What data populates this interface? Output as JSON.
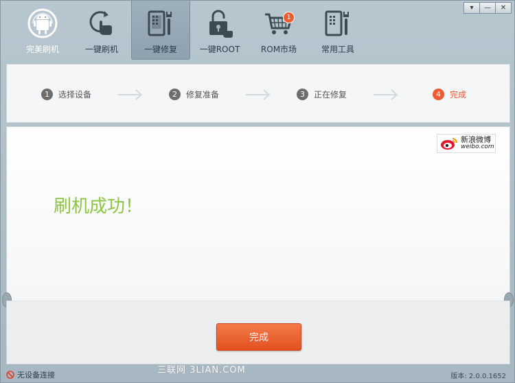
{
  "window": {
    "controls": [
      "▾",
      "—",
      "✕"
    ]
  },
  "toolbar": {
    "items": [
      {
        "label": "完美刷机",
        "icon": "android-icon"
      },
      {
        "label": "一键刷机",
        "icon": "refresh-hand-icon"
      },
      {
        "label": "一键修复",
        "icon": "phone-tools-icon",
        "active": true
      },
      {
        "label": "一键ROOT",
        "icon": "unlock-icon"
      },
      {
        "label": "ROM市场",
        "icon": "cart-icon",
        "badge": "1"
      },
      {
        "label": "常用工具",
        "icon": "toolbox-icon"
      }
    ]
  },
  "steps": [
    {
      "num": "1",
      "label": "选择设备"
    },
    {
      "num": "2",
      "label": "修复准备"
    },
    {
      "num": "3",
      "label": "正在修复"
    },
    {
      "num": "4",
      "label": "完成",
      "current": true
    }
  ],
  "weibo": {
    "cn": "新浪微博",
    "en": "weibo.com"
  },
  "main": {
    "message": "刷机成功！"
  },
  "actions": {
    "finish_label": "完成"
  },
  "status": {
    "device": "无设备连接",
    "version": "版本: 2.0.0.1652"
  },
  "watermark": "三联网 3LIAN.COM",
  "colors": {
    "accent": "#ef5b33",
    "success": "#8cc63f",
    "button": "#e8602c"
  }
}
